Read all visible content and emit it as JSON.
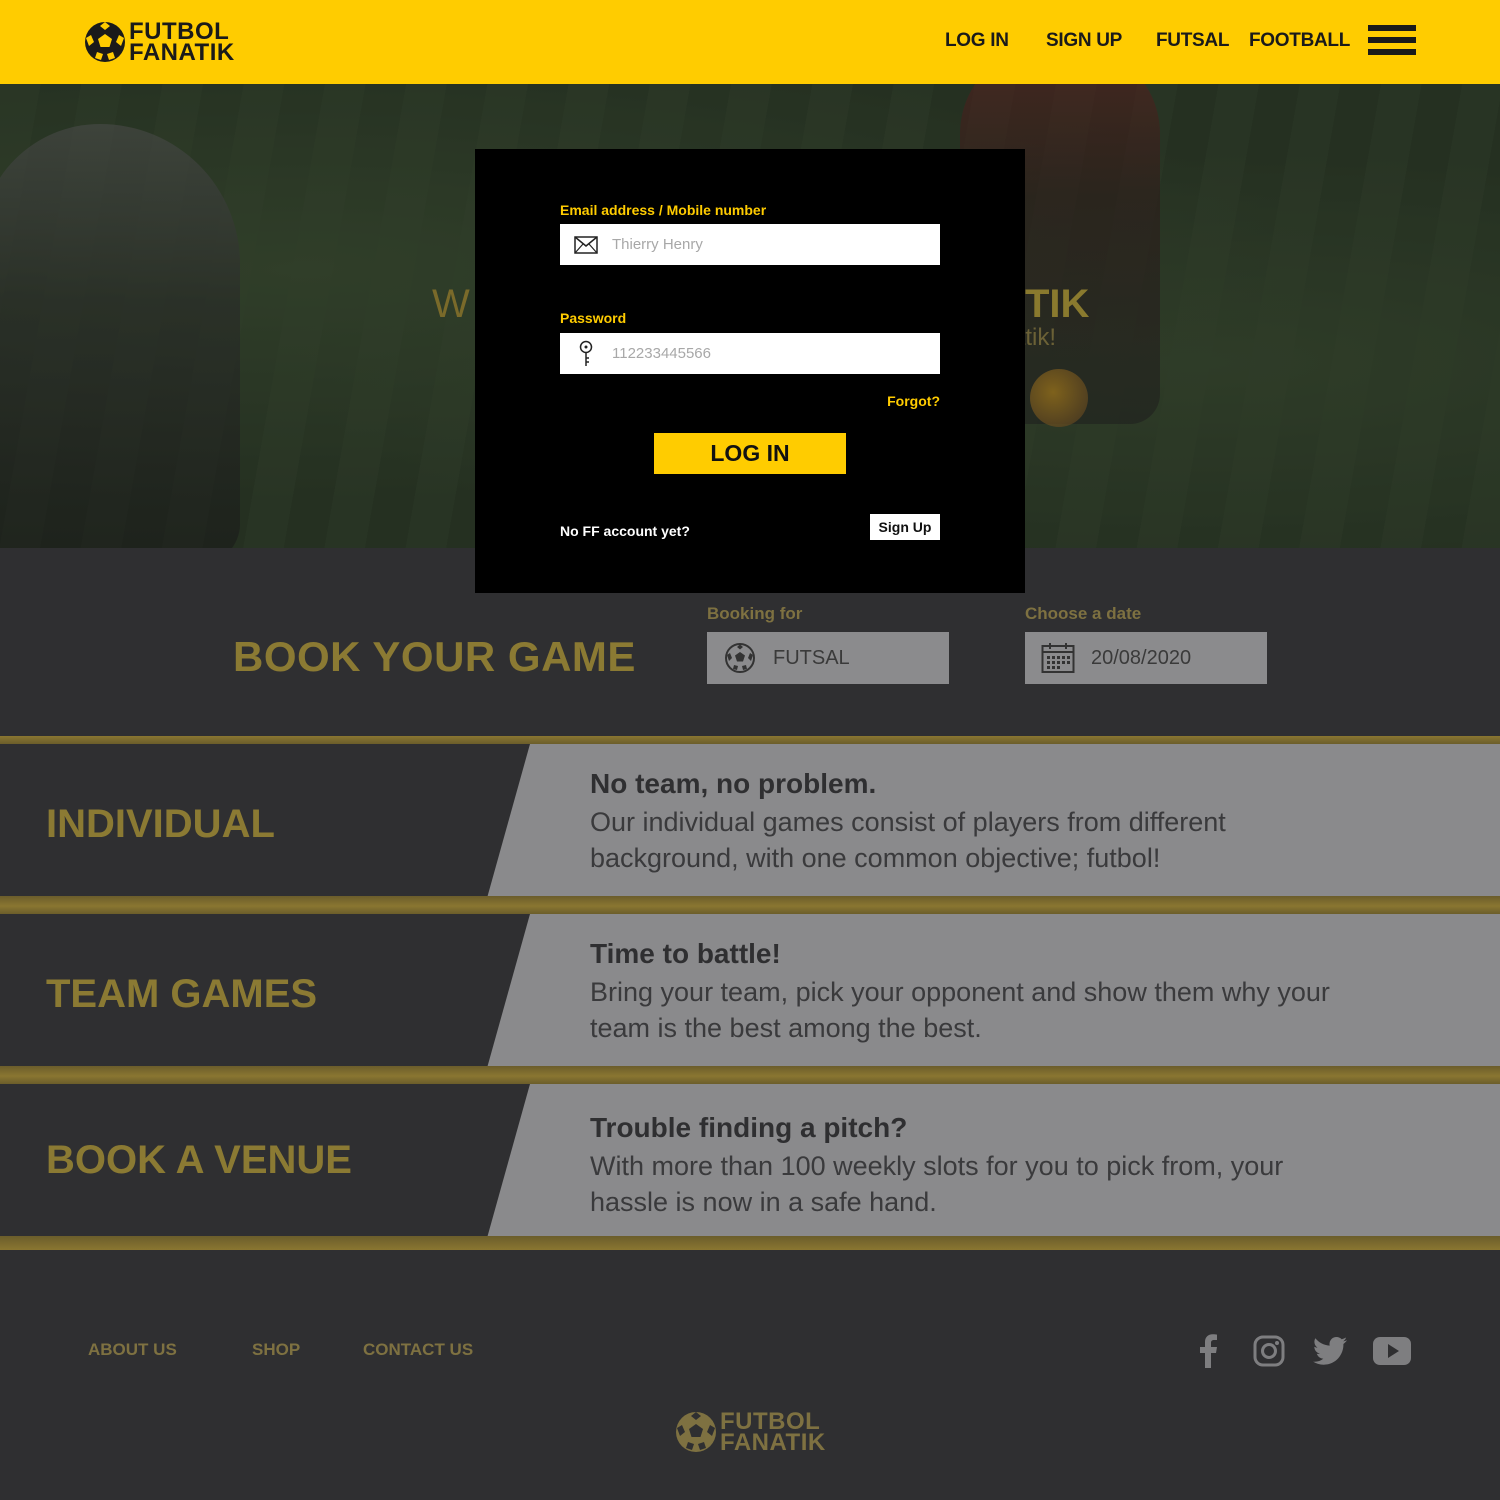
{
  "brand": {
    "line1": "FUTBOL",
    "line2": "FANATIK"
  },
  "nav": {
    "login": "LOG IN",
    "signup": "SIGN UP",
    "futsal": "FUTSAL",
    "football": "FOOTBALL"
  },
  "hero": {
    "ghost_left": "W",
    "ghost_right": "TIK",
    "ghost_right_sub": "atik!"
  },
  "login_modal": {
    "email_label": "Email address / Mobile number",
    "email_placeholder": "Thierry Henry",
    "password_label": "Password",
    "password_placeholder": "112233445566",
    "forgot": "Forgot?",
    "login_button": "LOG IN",
    "no_account": "No FF account yet?",
    "signup_button": "Sign Up"
  },
  "booking": {
    "title": "BOOK YOUR GAME",
    "booking_for_label": "Booking for",
    "booking_for_value": "FUTSAL",
    "date_label": "Choose a date",
    "date_value": "20/08/2020"
  },
  "features": [
    {
      "title": "INDIVIDUAL",
      "heading": "No team, no problem.",
      "text": "Our individual games consist of players from different background, with one common objective; futbol!"
    },
    {
      "title": "TEAM GAMES",
      "heading": "Time to battle!",
      "text": "Bring your team, pick your opponent and show them why your team is the best among the best."
    },
    {
      "title": "BOOK A VENUE",
      "heading": "Trouble finding a pitch?",
      "text": "With more than 100 weekly slots for you to pick from, your hassle is now in a safe hand."
    }
  ],
  "footer": {
    "links": [
      "ABOUT US",
      "SHOP",
      "CONTACT US"
    ],
    "social_icons": [
      "facebook-icon",
      "instagram-icon",
      "twitter-icon",
      "youtube-icon"
    ]
  },
  "colors": {
    "brand_yellow": "#ffcc00",
    "gold": "#8b7a33",
    "dark": "#2f2f31",
    "panel_grey": "#8a8a8c"
  }
}
